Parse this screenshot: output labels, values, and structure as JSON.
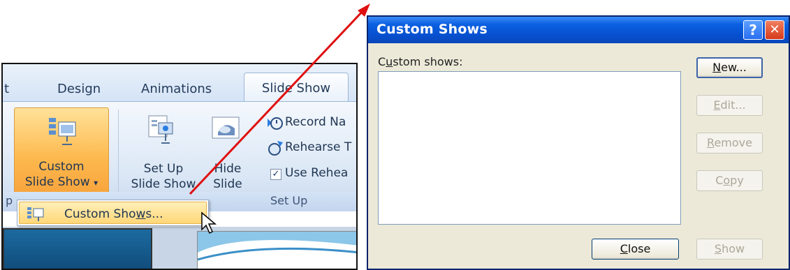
{
  "ribbon": {
    "tabs": [
      {
        "label": "t"
      },
      {
        "label": "Design"
      },
      {
        "label": "Animations"
      }
    ],
    "active_tab": "Slide Show",
    "custom_slide_show": {
      "line1": "Custom",
      "line2": "Slide Show",
      "arrow": "▾"
    },
    "set_up_slide_show": {
      "line1": "Set Up",
      "line2": "Slide Show"
    },
    "hide_slide": {
      "line1": "Hide",
      "line2": "Slide"
    },
    "record_narration": "Record Na",
    "rehearse_timings": "Rehearse T",
    "use_rehearsed": {
      "label": "Use Rehea",
      "checked": "✓"
    },
    "group_label": "Set Up",
    "group_label_left": "p",
    "dropdown": {
      "item_prefix": "Custom Sho",
      "item_underlined": "w",
      "item_suffix": "s..."
    }
  },
  "dialog": {
    "title": "Custom Shows",
    "help_button": "?",
    "close_x": "✕",
    "list_label_prefix": "C",
    "list_label_underlined": "u",
    "list_label_suffix": "stom shows:",
    "buttons": {
      "new": {
        "underlined": "N",
        "rest": "ew..."
      },
      "edit": {
        "underlined": "E",
        "rest": "dit..."
      },
      "remove": {
        "underlined": "R",
        "rest": "emove"
      },
      "copy": {
        "prefix": "C",
        "underlined": "o",
        "rest": "py"
      },
      "close": {
        "underlined": "C",
        "rest": "lose"
      },
      "show": {
        "underlined": "S",
        "rest": "how"
      }
    }
  },
  "colors": {
    "arrow": "#e01010",
    "title_bar": "#0750d0",
    "active_button": "#fdb94e"
  }
}
